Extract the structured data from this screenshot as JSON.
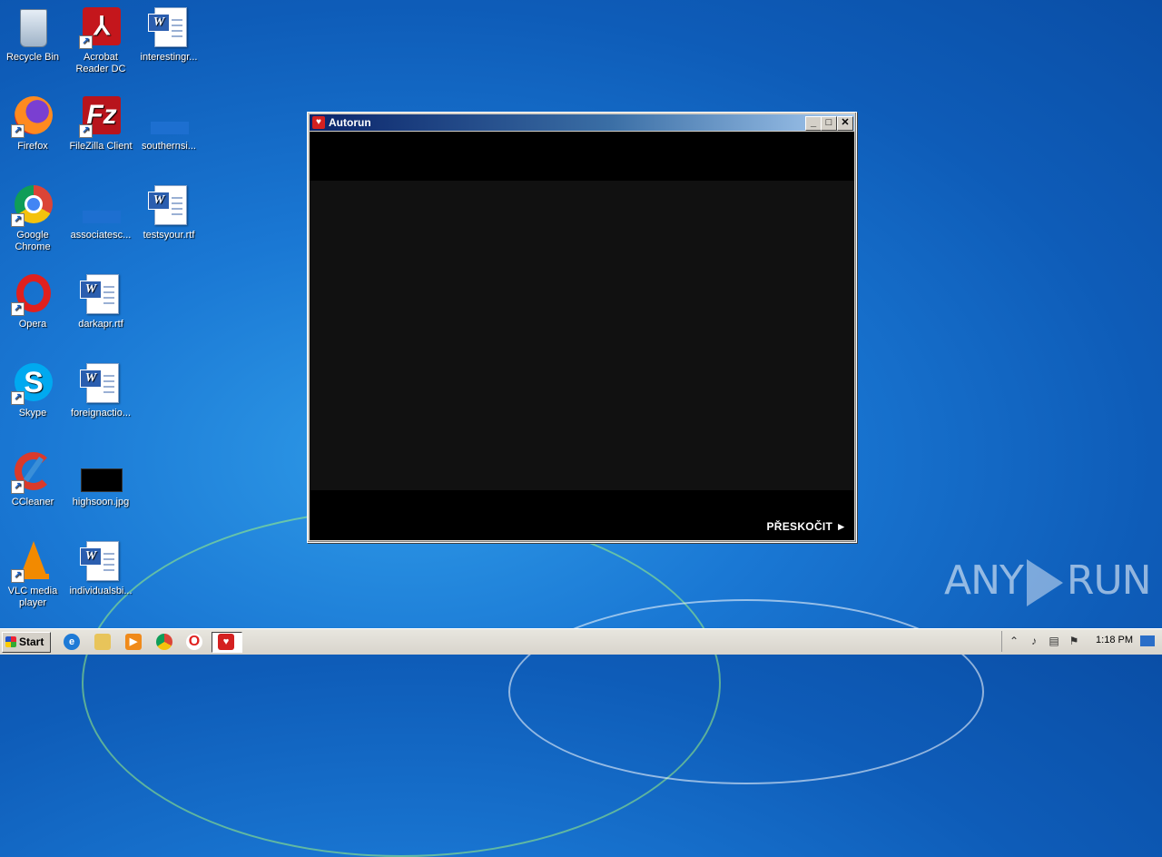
{
  "desktop": {
    "icons": [
      {
        "label": "Recycle Bin"
      },
      {
        "label": "Acrobat Reader DC"
      },
      {
        "label": "interestingr..."
      },
      {
        "label": "Firefox"
      },
      {
        "label": "FileZilla Client"
      },
      {
        "label": "southernsi..."
      },
      {
        "label": "Google Chrome"
      },
      {
        "label": "associatesc..."
      },
      {
        "label": "testsyour.rtf"
      },
      {
        "label": "Opera"
      },
      {
        "label": "darkapr.rtf"
      },
      {
        "label": "Skype"
      },
      {
        "label": "foreignactio..."
      },
      {
        "label": "CCleaner"
      },
      {
        "label": "highsoon.jpg"
      },
      {
        "label": "VLC media player"
      },
      {
        "label": "individualsbi..."
      }
    ]
  },
  "window": {
    "title": "Autorun",
    "skip_label": "PŘESKOČIT ►",
    "minimize": "_",
    "maximize": "□",
    "close": "✕"
  },
  "taskbar": {
    "start_label": "Start",
    "clock": "1:18 PM",
    "apps": [
      "ie-icon",
      "explorer-icon",
      "media-player-icon",
      "chrome-icon",
      "opera-icon",
      "autorun-icon"
    ]
  },
  "watermark": {
    "text_left": "ANY",
    "text_right": "RUN"
  }
}
